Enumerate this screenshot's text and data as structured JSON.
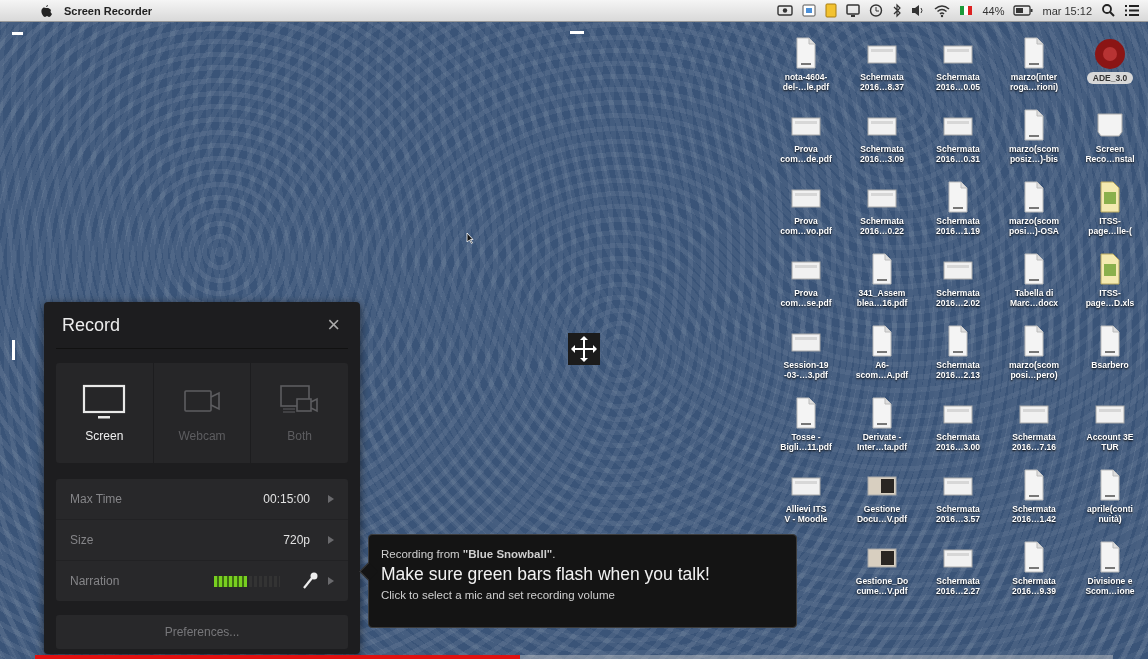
{
  "menu_bar": {
    "app_name": "Screen Recorder",
    "status_items": [
      {
        "kind": "camera"
      },
      {
        "kind": "capture"
      },
      {
        "kind": "note"
      },
      {
        "kind": "display"
      },
      {
        "kind": "clock"
      },
      {
        "kind": "bluetooth"
      },
      {
        "kind": "volume"
      },
      {
        "kind": "wifi"
      },
      {
        "kind": "flag"
      },
      {
        "kind": "text",
        "text": "44%"
      },
      {
        "kind": "battery"
      },
      {
        "kind": "text",
        "text": "mar 15:12"
      },
      {
        "kind": "search"
      },
      {
        "kind": "list"
      }
    ]
  },
  "desktop_rows": [
    [
      {
        "kind": "doc",
        "lines": [
          "nota-4604-",
          "del-…le.pdf"
        ]
      },
      {
        "kind": "image",
        "lines": [
          "Schermata",
          "2016…8.37"
        ]
      },
      {
        "kind": "image",
        "lines": [
          "Schermata",
          "2016…0.05"
        ]
      },
      {
        "kind": "doc",
        "lines": [
          "marzo(inter",
          "roga…rioni)"
        ]
      },
      {
        "kind": "app",
        "lines": [
          "ADE_3.0"
        ]
      }
    ],
    [
      {
        "kind": "image",
        "lines": [
          "Prova",
          "com…de.pdf"
        ]
      },
      {
        "kind": "image",
        "lines": [
          "Schermata",
          "2016…3.09"
        ]
      },
      {
        "kind": "image",
        "lines": [
          "Schermata",
          "2016…0.31"
        ]
      },
      {
        "kind": "doc",
        "lines": [
          "marzo(scom",
          "posiz…)-bis"
        ]
      },
      {
        "kind": "disk",
        "lines": [
          "Screen",
          "Reco…nstal"
        ]
      }
    ],
    [
      {
        "kind": "image",
        "lines": [
          "Prova",
          "com…vo.pdf"
        ]
      },
      {
        "kind": "image",
        "lines": [
          "Schermata",
          "2016…0.22"
        ]
      },
      {
        "kind": "doc",
        "lines": [
          "Schermata",
          "2016…1.19"
        ]
      },
      {
        "kind": "doc",
        "lines": [
          "marzo(scom",
          "posi…)-OSA"
        ]
      },
      {
        "kind": "sheet",
        "lines": [
          "ITSS-",
          "page…lle-("
        ]
      }
    ],
    [
      {
        "kind": "image",
        "lines": [
          "Prova",
          "com…se.pdf"
        ]
      },
      {
        "kind": "doc",
        "lines": [
          "341_Assem",
          "blea…16.pdf"
        ]
      },
      {
        "kind": "image",
        "lines": [
          "Schermata",
          "2016…2.02"
        ]
      },
      {
        "kind": "doc",
        "lines": [
          "Tabella di",
          "Marc…docx"
        ]
      },
      {
        "kind": "sheet",
        "lines": [
          "ITSS-",
          "page…D.xls"
        ]
      }
    ],
    [
      {
        "kind": "image",
        "lines": [
          "Session-19",
          "-03-…3.pdf"
        ]
      },
      {
        "kind": "doc",
        "lines": [
          "A6-",
          "scom…A.pdf"
        ]
      },
      {
        "kind": "doc",
        "lines": [
          "Schermata",
          "2016…2.13"
        ]
      },
      {
        "kind": "doc",
        "lines": [
          "marzo(scom",
          "posi…pero)"
        ]
      },
      {
        "kind": "doc",
        "lines": [
          "Bsarbero"
        ]
      }
    ],
    [
      {
        "kind": "doc",
        "lines": [
          "Tosse -",
          "Bigli…11.pdf"
        ]
      },
      {
        "kind": "doc",
        "lines": [
          "Derivate -",
          "Inter…ta.pdf"
        ]
      },
      {
        "kind": "image",
        "lines": [
          "Schermata",
          "2016…3.00"
        ]
      },
      {
        "kind": "image",
        "lines": [
          "Schermata",
          "2016…7.16"
        ]
      },
      {
        "kind": "image",
        "lines": [
          "Account 3E",
          "TUR"
        ]
      }
    ],
    [
      {
        "kind": "image",
        "lines": [
          "Allievi ITS",
          "V - Moodle"
        ]
      },
      {
        "kind": "thumb",
        "lines": [
          "Gestione",
          "Docu…V.pdf"
        ]
      },
      {
        "kind": "image",
        "lines": [
          "Schermata",
          "2016…3.57"
        ]
      },
      {
        "kind": "doc",
        "lines": [
          "Schermata",
          "2016…1.42"
        ]
      },
      {
        "kind": "doc",
        "lines": [
          "aprile(conti",
          "nuità)"
        ]
      }
    ],
    [
      {
        "kind": "thumb",
        "lines": [
          "Gestione_Do",
          "cume…V.pdf"
        ]
      },
      {
        "kind": "image",
        "lines": [
          "Schermata",
          "2016…2.27"
        ]
      },
      {
        "kind": "doc",
        "lines": [
          "Schermata",
          "2016…9.39"
        ]
      },
      {
        "kind": "doc",
        "lines": [
          "Divisione e",
          "Scom…ione"
        ]
      }
    ]
  ],
  "record_panel": {
    "title": "Record",
    "close": "×",
    "modes": [
      {
        "kind": "screen",
        "label": "Screen",
        "selected": true
      },
      {
        "kind": "webcam",
        "label": "Webcam",
        "selected": false
      },
      {
        "kind": "both",
        "label": "Both",
        "selected": false
      }
    ],
    "settings": [
      {
        "kind": "value",
        "label": "Max Time",
        "value": "00:15:00"
      },
      {
        "kind": "value",
        "label": "Size",
        "value": "720p"
      },
      {
        "kind": "meter",
        "label": "Narration",
        "level": 0.5
      }
    ],
    "preferences_button": "Preferences..."
  },
  "tooltip": {
    "source": "Recording from **\"Blue Snowball\"**.",
    "headline": "Make sure green bars flash when you talk!",
    "hint": "Click to select a mic and set recording volume"
  },
  "video_progress": {
    "level": 0.45
  }
}
